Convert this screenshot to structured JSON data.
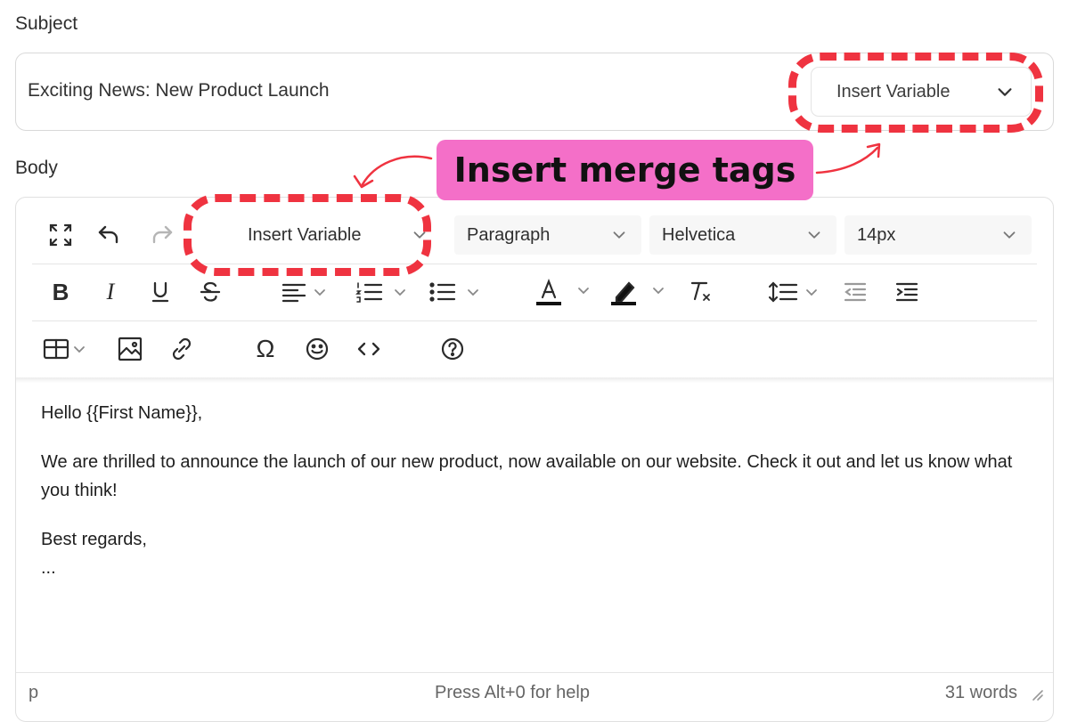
{
  "subject": {
    "label": "Subject",
    "value": "Exciting News: New Product Launch",
    "insert_variable_label": "Insert Variable"
  },
  "body": {
    "label": "Body",
    "toolbar": {
      "insert_variable_label": "Insert Variable",
      "block_format": "Paragraph",
      "font_family": "Helvetica",
      "font_size": "14px"
    },
    "content": {
      "greeting": "Hello {{First Name}},",
      "paragraph": "We are thrilled to announce the launch of our new product, now available on our website. Check it out and let us know what you think!",
      "closing": "Best regards,",
      "ellipsis": "..."
    },
    "statusbar": {
      "element_path": "p",
      "help_text": "Press Alt+0 for help",
      "word_count": "31 words"
    }
  },
  "annotation": {
    "callout_text": "Insert merge tags",
    "highlight_color": "#ef3340",
    "callout_color": "#f46fc8"
  }
}
